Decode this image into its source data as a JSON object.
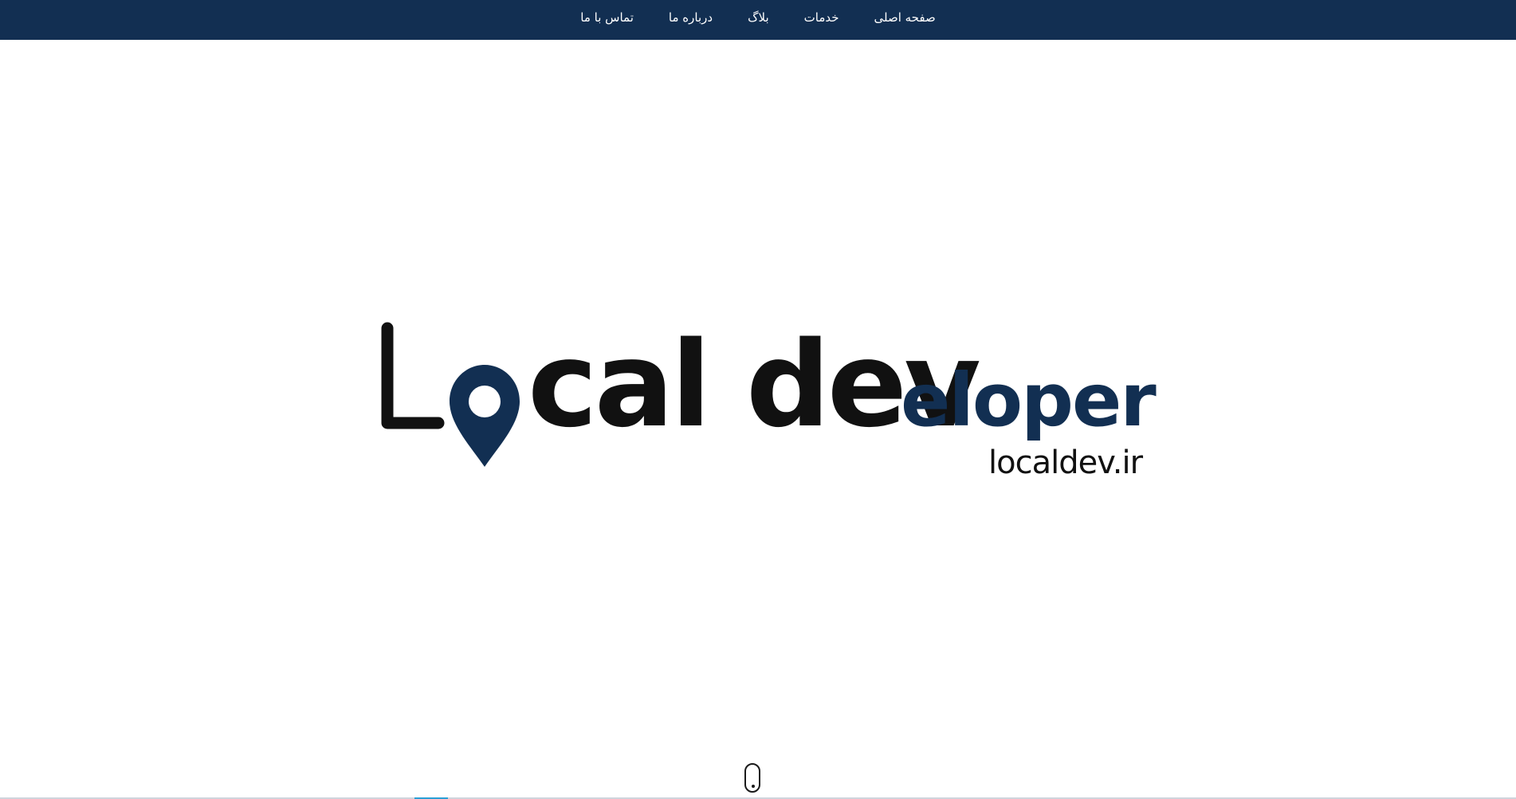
{
  "nav": {
    "items": [
      {
        "label": "صفحه اصلی"
      },
      {
        "label": "خدمات"
      },
      {
        "label": "بلاگ"
      },
      {
        "label": "درباره ما"
      },
      {
        "label": "تماس با ما"
      }
    ]
  },
  "logo": {
    "part_dark": "Local dev",
    "part_accent": "eloper",
    "domain": "localdev.ir",
    "icon": "map-pin-icon"
  },
  "scroll_indicator": {
    "icon": "mouse-scroll-icon"
  },
  "colors": {
    "navbar_bg": "#122f52",
    "logo_dark": "#111111",
    "logo_accent": "#122f52",
    "background": "#ffffff"
  }
}
